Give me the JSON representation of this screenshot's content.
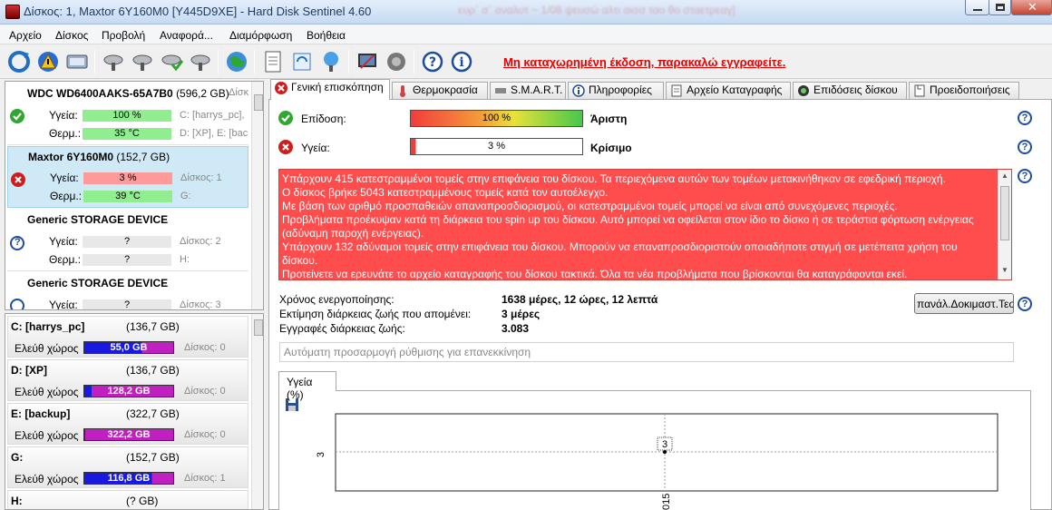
{
  "window": {
    "title": "Δίσκος: 1, Maxtor 6Y160M0 [Y445D9XE]  -  Hard Disk Sentinel 4.60",
    "blurred_header": "ευρ΄ σ΄ αναλυτ  ~  1/08 ψευσώ αλτι αισσ ταο θο σταετρεαγ]"
  },
  "menu": [
    "Αρχείο",
    "Δίσκος",
    "Προβολή",
    "Αναφορά...",
    "Διαμόρφωση",
    "Βοήθεια"
  ],
  "toolbar": {
    "notice": "Μη καταχωρημένη έκδοση, παρακαλώ εγγραφείτε."
  },
  "disks": [
    {
      "name": "WDC WD6400AAKS-65A7B0",
      "size": "(596,2 GB)",
      "side_title": "Δίσκ",
      "health_label": "Υγεία:",
      "health": "100 %",
      "health_pct": 100,
      "temp_label": "Θερμ.:",
      "temp": "35 °C",
      "partitions_line1": "C: [harrys_pc],",
      "partitions_line2": "D: [XP], E: [bac",
      "status": "ok"
    },
    {
      "name": "Maxtor 6Y160M0",
      "size": "(152,7 GB)",
      "side_title": "",
      "health_label": "Υγεία:",
      "health": "3 %",
      "health_pct": 3,
      "temp_label": "Θερμ.:",
      "temp": "39 °C",
      "partitions_line1": "Δίσκος: 1",
      "partitions_line2": "G:",
      "status": "error"
    },
    {
      "name": "Generic STORAGE DEVICE",
      "size": "",
      "side_title": "",
      "health_label": "Υγεία:",
      "health": "?",
      "temp_label": "Θερμ.:",
      "temp": "?",
      "partitions_line1": "Δίσκος: 2",
      "partitions_line2": "H:",
      "status": "unknown"
    },
    {
      "name": "Generic STORAGE DEVICE",
      "size": "",
      "side_title": "",
      "health_label": "Υγεία:",
      "health": "?",
      "partitions_line1": "Δίσκος: 3",
      "status": "unknown"
    }
  ],
  "partitions": [
    {
      "name": "C: [harrys_pc]",
      "size": "(136,7 GB)",
      "free_label": "Ελεύθ χώρος",
      "free": "55,0 GB",
      "free_pct": 40,
      "disk": "Δίσκος: 0"
    },
    {
      "name": "D: [XP]",
      "size": "(136,7 GB)",
      "free_label": "Ελεύθ χώρος",
      "free": "128,2 GB",
      "free_pct": 8,
      "disk": "Δίσκος: 0"
    },
    {
      "name": "E: [backup]",
      "size": "(322,7 GB)",
      "free_label": "Ελεύθ χώρος",
      "free": "322,2 GB",
      "free_pct": 1,
      "disk": "Δίσκος: 0"
    },
    {
      "name": "G:",
      "size": "(152,7 GB)",
      "free_label": "Ελεύθ χώρος",
      "free": "116,8 GB",
      "free_pct": 24,
      "disk": "Δίσκος: 1"
    },
    {
      "name": "H:",
      "size": "(? GB)"
    }
  ],
  "tabs": [
    "Γενική επισκόπηση",
    "Θερμοκρασία",
    "S.M.A.R.T.",
    "Πληροφορίες",
    "Αρχείο Καταγραφής",
    "Επιδόσεις δίσκου",
    "Προειδοποιήσεις"
  ],
  "overview": {
    "performance_label": "Επίδοση:",
    "performance_value": "100 %",
    "performance_pct": 100,
    "performance_rating": "Άριστη",
    "health_label": "Υγεία:",
    "health_value": "3 %",
    "health_pct": 3,
    "health_rating": "Κρίσιμο",
    "messages": [
      "Υπάρχουν 415 κατεστραμμένοι τομείς στην επιφάνεια του δίσκου. Τα περιεχόμενα αυτών των τομέων μετακινήθηκαν σε εφεδρική περιοχή.",
      "Ο δίσκος βρήκε 5043 κατεστραμμένους τομείς κατά τον αυτοέλεγχο.",
      "Με βάση των αριθμό προσπαθειών απαναπροσδιορισμού, οι κατεστραμμένοι τομείς μπορεί να είναι από συνεχόμενες περιοχές.",
      "Προβλήματα προέκυψαν κατά τη διάρκεια του spin up του δίσκου. Αυτό μπορεί να οφείλεται στον ίδιο το δίσκο ή σε τεράστια φόρτωση ενέργειας",
      "(αδύναμη παροχή ενέργειας).",
      "Υπάρχουν 132 αδύναμοι τομείς στην επιφάνεια του δίσκου. Μπορούν να επαναπροσδιοριστούν οποιαδήποτε στιγμή σε μετέπειτα χρήση του",
      "δίσκου.",
      "Προτείνετε να ερευνάτε το αρχείο καταγραφής του δίσκου τακτικά. Όλα τα νέα προβλήματα που βρίσκονται θα καταγράφονται εκεί."
    ],
    "power_on_label": "Χρόνος ενεργοποίησης:",
    "power_on_value": "1638 μέρες, 12 ώρες, 12 λεπτά",
    "remaining_label": "Εκτίμηση διάρκειας ζωής που απομένει:",
    "remaining_value": "3 μέρες",
    "records_label": "Εγγραφές διάρκειας ζωής:",
    "records_value": "3.083",
    "test_button": "πανάλ.Δοκιμαστ.Τεστ",
    "auto_placeholder": "Αυτόματη προσαρμογή ρύθμισης για επανεκκίνηση"
  },
  "chart_tab": "Υγεία (%)",
  "chart_data": {
    "type": "line",
    "title": "",
    "ylabel": "",
    "xlabel": "",
    "yticks": [
      "3"
    ],
    "xticks": [
      "015"
    ],
    "series": [
      {
        "values": [
          3
        ],
        "labels": [
          "3"
        ]
      }
    ]
  },
  "colors": {
    "ok_green": "#2fa82f",
    "error_red": "#d11c1c",
    "unknown_blue": "#1d4d9c",
    "message_bg": "#ff4d4d",
    "notice_red": "#e60000"
  }
}
